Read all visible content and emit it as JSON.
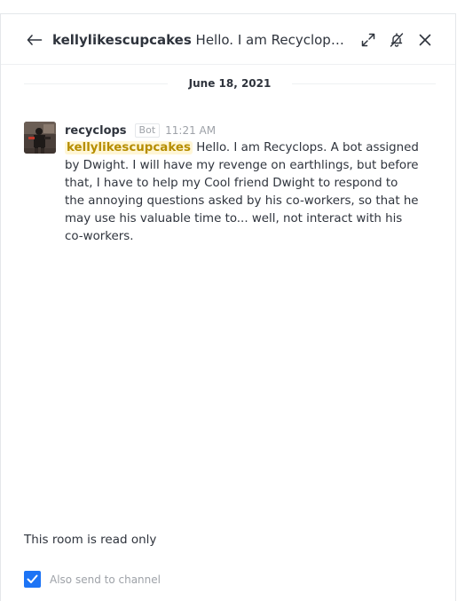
{
  "header": {
    "username": "kellylikescupcakes",
    "message_preview": "Hello. I am Recyclops. A bot assigned by Dwight. I will have my revenge on earthlings, but before that, I have to help my Cool friend Dwight to respond to the annoying questions asked by his co-workers, so that he may use his valuable time to... well, not interact with his co-workers."
  },
  "date_divider": "June 18, 2021",
  "message": {
    "sender": "recyclops",
    "badge": "Bot",
    "time": "11:21 AM",
    "mention": "kellylikescupcakes",
    "text": "Hello. I am Recyclops. A bot assigned by Dwight. I will have my revenge on earthlings, but before that, I have to help my Cool friend Dwight to respond to the annoying questions asked by his co-workers, so that he may use his valuable time to... well, not interact with his co-workers."
  },
  "footer": {
    "readonly_text": "This room is read only",
    "also_send_label": "Also send to channel",
    "also_send_checked": true
  },
  "colors": {
    "accent": "#1d74f5",
    "mention_bg": "#fff6d6",
    "mention_text": "#b68d00"
  }
}
